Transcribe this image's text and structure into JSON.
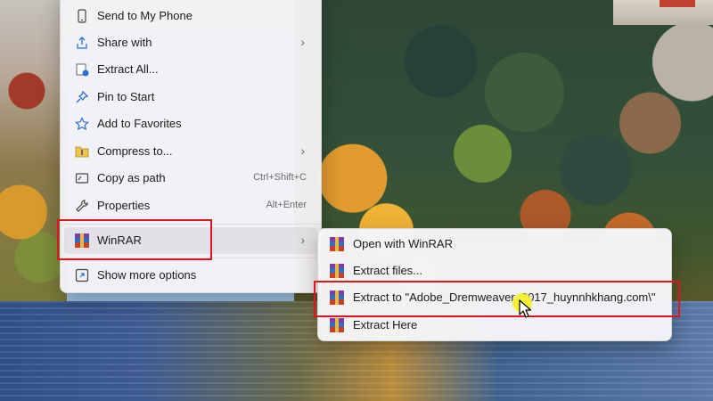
{
  "menu": {
    "items": [
      {
        "label": "Send to My Phone",
        "icon": "phone-icon"
      },
      {
        "label": "Share with",
        "icon": "share-icon",
        "submenu": true
      },
      {
        "label": "Extract All...",
        "icon": "extract-all-icon"
      },
      {
        "label": "Pin to Start",
        "icon": "pin-icon"
      },
      {
        "label": "Add to Favorites",
        "icon": "star-icon"
      },
      {
        "label": "Compress to...",
        "icon": "folder-zip-icon",
        "submenu": true
      },
      {
        "label": "Copy as path",
        "icon": "copy-path-icon",
        "shortcut": "Ctrl+Shift+C"
      },
      {
        "label": "Properties",
        "icon": "wrench-icon",
        "shortcut": "Alt+Enter"
      },
      {
        "label": "WinRAR",
        "icon": "winrar-icon",
        "submenu": true
      },
      {
        "label": "Show more options",
        "icon": "show-more-icon"
      }
    ]
  },
  "submenu": {
    "items": [
      {
        "label": "Open with WinRAR",
        "icon": "winrar-icon"
      },
      {
        "label": "Extract files...",
        "icon": "winrar-icon"
      },
      {
        "label": "Extract to \"Adobe_Dremweaver_2017_huynnhkhang.com\\\"",
        "icon": "winrar-icon"
      },
      {
        "label": "Extract Here",
        "icon": "winrar-icon"
      }
    ]
  },
  "colors": {
    "highlight": "#e0141e",
    "accent": "#2b6fd6",
    "cursor_glow": "#f6ef38"
  }
}
